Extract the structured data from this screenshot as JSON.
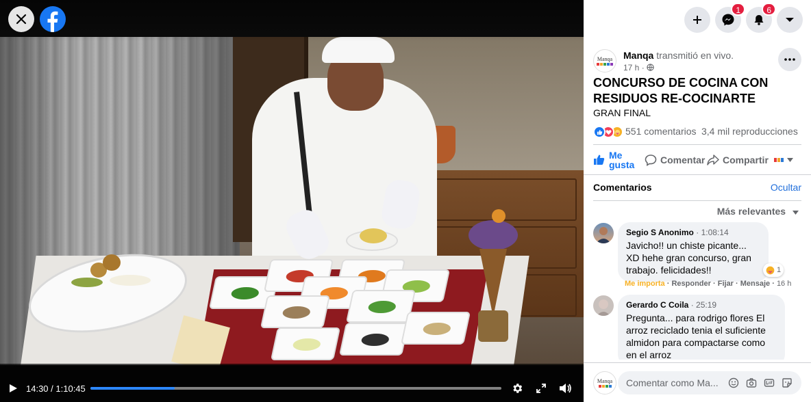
{
  "video": {
    "time_current": "14:30",
    "time_total": "1:10:45",
    "time_separator": " / ",
    "progress": 0.205,
    "icons": [
      "close-icon",
      "facebook-logo",
      "play-icon",
      "settings-gear-icon",
      "fullscreen-icon",
      "volume-icon"
    ]
  },
  "topbar": {
    "messenger_badge": "1",
    "notifications_badge": "6",
    "icons": [
      "plus-icon",
      "messenger-icon",
      "bell-icon",
      "caret-down-icon"
    ]
  },
  "post": {
    "avatar_text": "Manqa",
    "author": "Manqa",
    "action_text": " transmitió en vivo.",
    "timestamp": "17 h",
    "privacy": "Público",
    "title": "CONCURSO DE COCINA CON RESIDUOS RE-COCINARTE",
    "subtitle": "GRAN FINAL",
    "comment_count": "551 comentarios",
    "view_count": "3,4 mil reproducciones",
    "reaction_icons": [
      "like-reaction-icon",
      "love-reaction-icon",
      "care-reaction-icon"
    ]
  },
  "actions": {
    "like": "Me gusta",
    "comment": "Comentar",
    "share": "Compartir"
  },
  "comments_section": {
    "heading": "Comentarios",
    "hide": "Ocultar",
    "sort": "Más relevantes",
    "items": [
      {
        "name": "Segio S Anonimo",
        "video_time": "1:08:14",
        "text": "Javicho!! un chiste picante... XD hehe gran concurso, gran trabajo. felicidades!!",
        "reaction_count": "1",
        "liked_label": "Me importa",
        "reply": "Responder",
        "pin": "Fijar",
        "message": "Mensaje",
        "age": "16 h"
      },
      {
        "name": "Gerardo C Coila",
        "video_time": "25:19",
        "text": "Pregunta... para rodrigo flores El arroz reciclado tenia el suficiente almidon para compactarse como en el arroz"
      }
    ]
  },
  "composer": {
    "placeholder": "Comentar como Ma...",
    "icons": [
      "emoji-icon",
      "camera-icon",
      "gif-icon",
      "sticker-icon"
    ]
  },
  "colors": {
    "accent": "#1877f2",
    "link": "#216fdb",
    "badge": "#e41e3f",
    "seek_fill": "#2d88ff",
    "like_label": "#f7b125"
  }
}
